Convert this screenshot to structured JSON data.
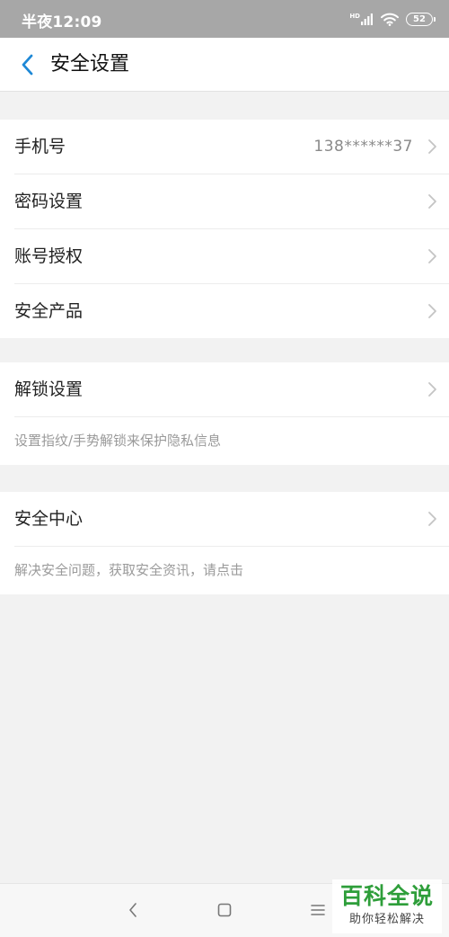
{
  "status_bar": {
    "time": "半夜12:09",
    "network_label": "HD",
    "battery": "52"
  },
  "header": {
    "title": "安全设置"
  },
  "groups": [
    {
      "items": [
        {
          "label": "手机号",
          "value": "138******37"
        },
        {
          "label": "密码设置"
        },
        {
          "label": "账号授权"
        },
        {
          "label": "安全产品"
        }
      ]
    },
    {
      "items": [
        {
          "label": "解锁设置"
        }
      ],
      "description": "设置指纹/手势解锁来保护隐私信息"
    },
    {
      "items": [
        {
          "label": "安全中心"
        }
      ],
      "description": "解决安全问题，获取安全资讯，请点击"
    }
  ],
  "nav_bar": {
    "icons": [
      "back-icon",
      "home-icon",
      "menu-icon"
    ]
  },
  "watermark": {
    "title": "百科全说",
    "subtitle": "助你轻松解决"
  },
  "colors": {
    "accent": "#1e88d6",
    "watermark_green": "#2e9e3a",
    "status_bar_bg": "#a7a7a7"
  }
}
